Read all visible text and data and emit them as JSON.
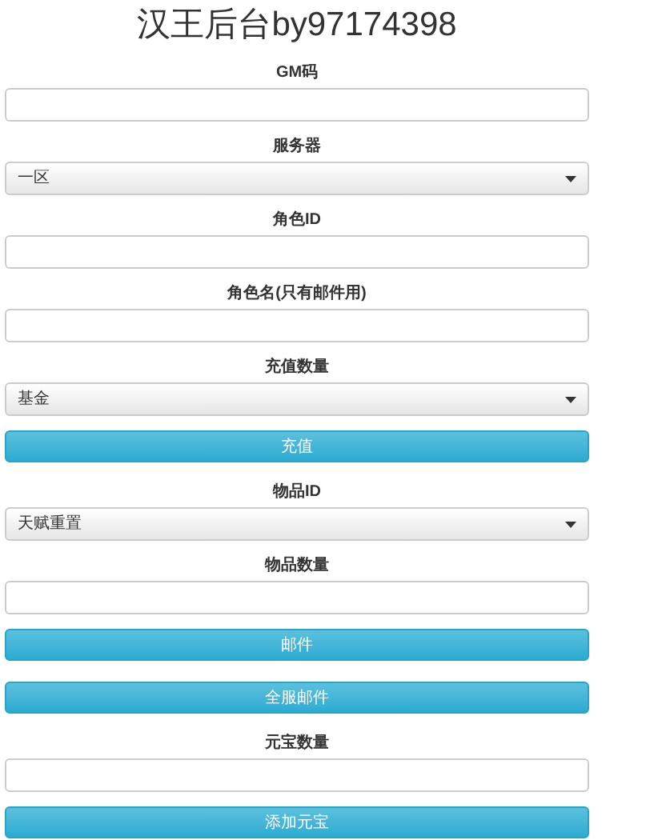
{
  "title": "汉王后台by97174398",
  "form": [
    {
      "kind": "label",
      "text": "GM码"
    },
    {
      "kind": "input"
    },
    {
      "kind": "label",
      "text": "服务器"
    },
    {
      "kind": "select",
      "value": "一区"
    },
    {
      "kind": "label",
      "text": "角色ID"
    },
    {
      "kind": "input"
    },
    {
      "kind": "label",
      "text": "角色名(只有邮件用)"
    },
    {
      "kind": "input"
    },
    {
      "kind": "label",
      "text": "充值数量"
    },
    {
      "kind": "select",
      "value": "基金"
    },
    {
      "kind": "button",
      "text": "充值"
    },
    {
      "kind": "label",
      "text": "物品ID"
    },
    {
      "kind": "select",
      "value": "天赋重置"
    },
    {
      "kind": "label",
      "text": "物品数量"
    },
    {
      "kind": "input"
    },
    {
      "kind": "button",
      "text": "邮件"
    },
    {
      "kind": "button",
      "text": "全服邮件"
    },
    {
      "kind": "label",
      "text": "元宝数量"
    },
    {
      "kind": "input"
    },
    {
      "kind": "button",
      "text": "添加元宝"
    }
  ]
}
